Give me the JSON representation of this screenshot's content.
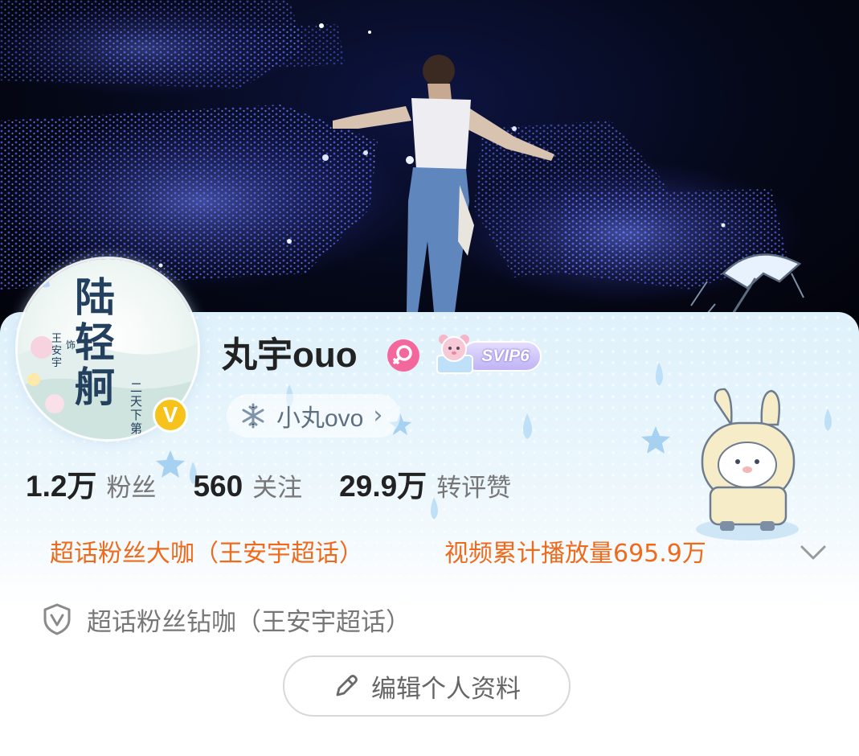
{
  "profile": {
    "username": "丸宇ouo",
    "nickname": "小丸ovo",
    "vip_badge": "SVIP6",
    "verified_mark": "V",
    "gender": "female",
    "avatar": {
      "title": "陆轻舸",
      "actor": "王安宇",
      "role_mark": "饰",
      "tag": "二天下第"
    }
  },
  "stats": [
    {
      "value": "1.2万",
      "label": "粉丝"
    },
    {
      "value": "560",
      "label": "关注"
    },
    {
      "value": "29.9万",
      "label": "转评赞"
    }
  ],
  "honors": {
    "super_topic": "超话粉丝大咖（王安宇超话）",
    "video_plays": "视频累计播放量695.9万"
  },
  "fan_level": {
    "text": "超话粉丝钻咖（王安宇超话）"
  },
  "actions": {
    "edit_profile": "编辑个人资料"
  },
  "colors": {
    "honor_orange": "#f06a1c",
    "svip_purple": "#bfb3f5",
    "gender_pink": "#f4679c",
    "verify_gold": "#f7c21a",
    "card_top": "#dff1fb"
  },
  "icons": [
    "gender-female-icon",
    "svip-bear-icon",
    "snowflake-icon",
    "chevron-right-icon",
    "chevron-down-icon",
    "shield-v-icon",
    "pencil-icon",
    "verified-v-icon"
  ]
}
